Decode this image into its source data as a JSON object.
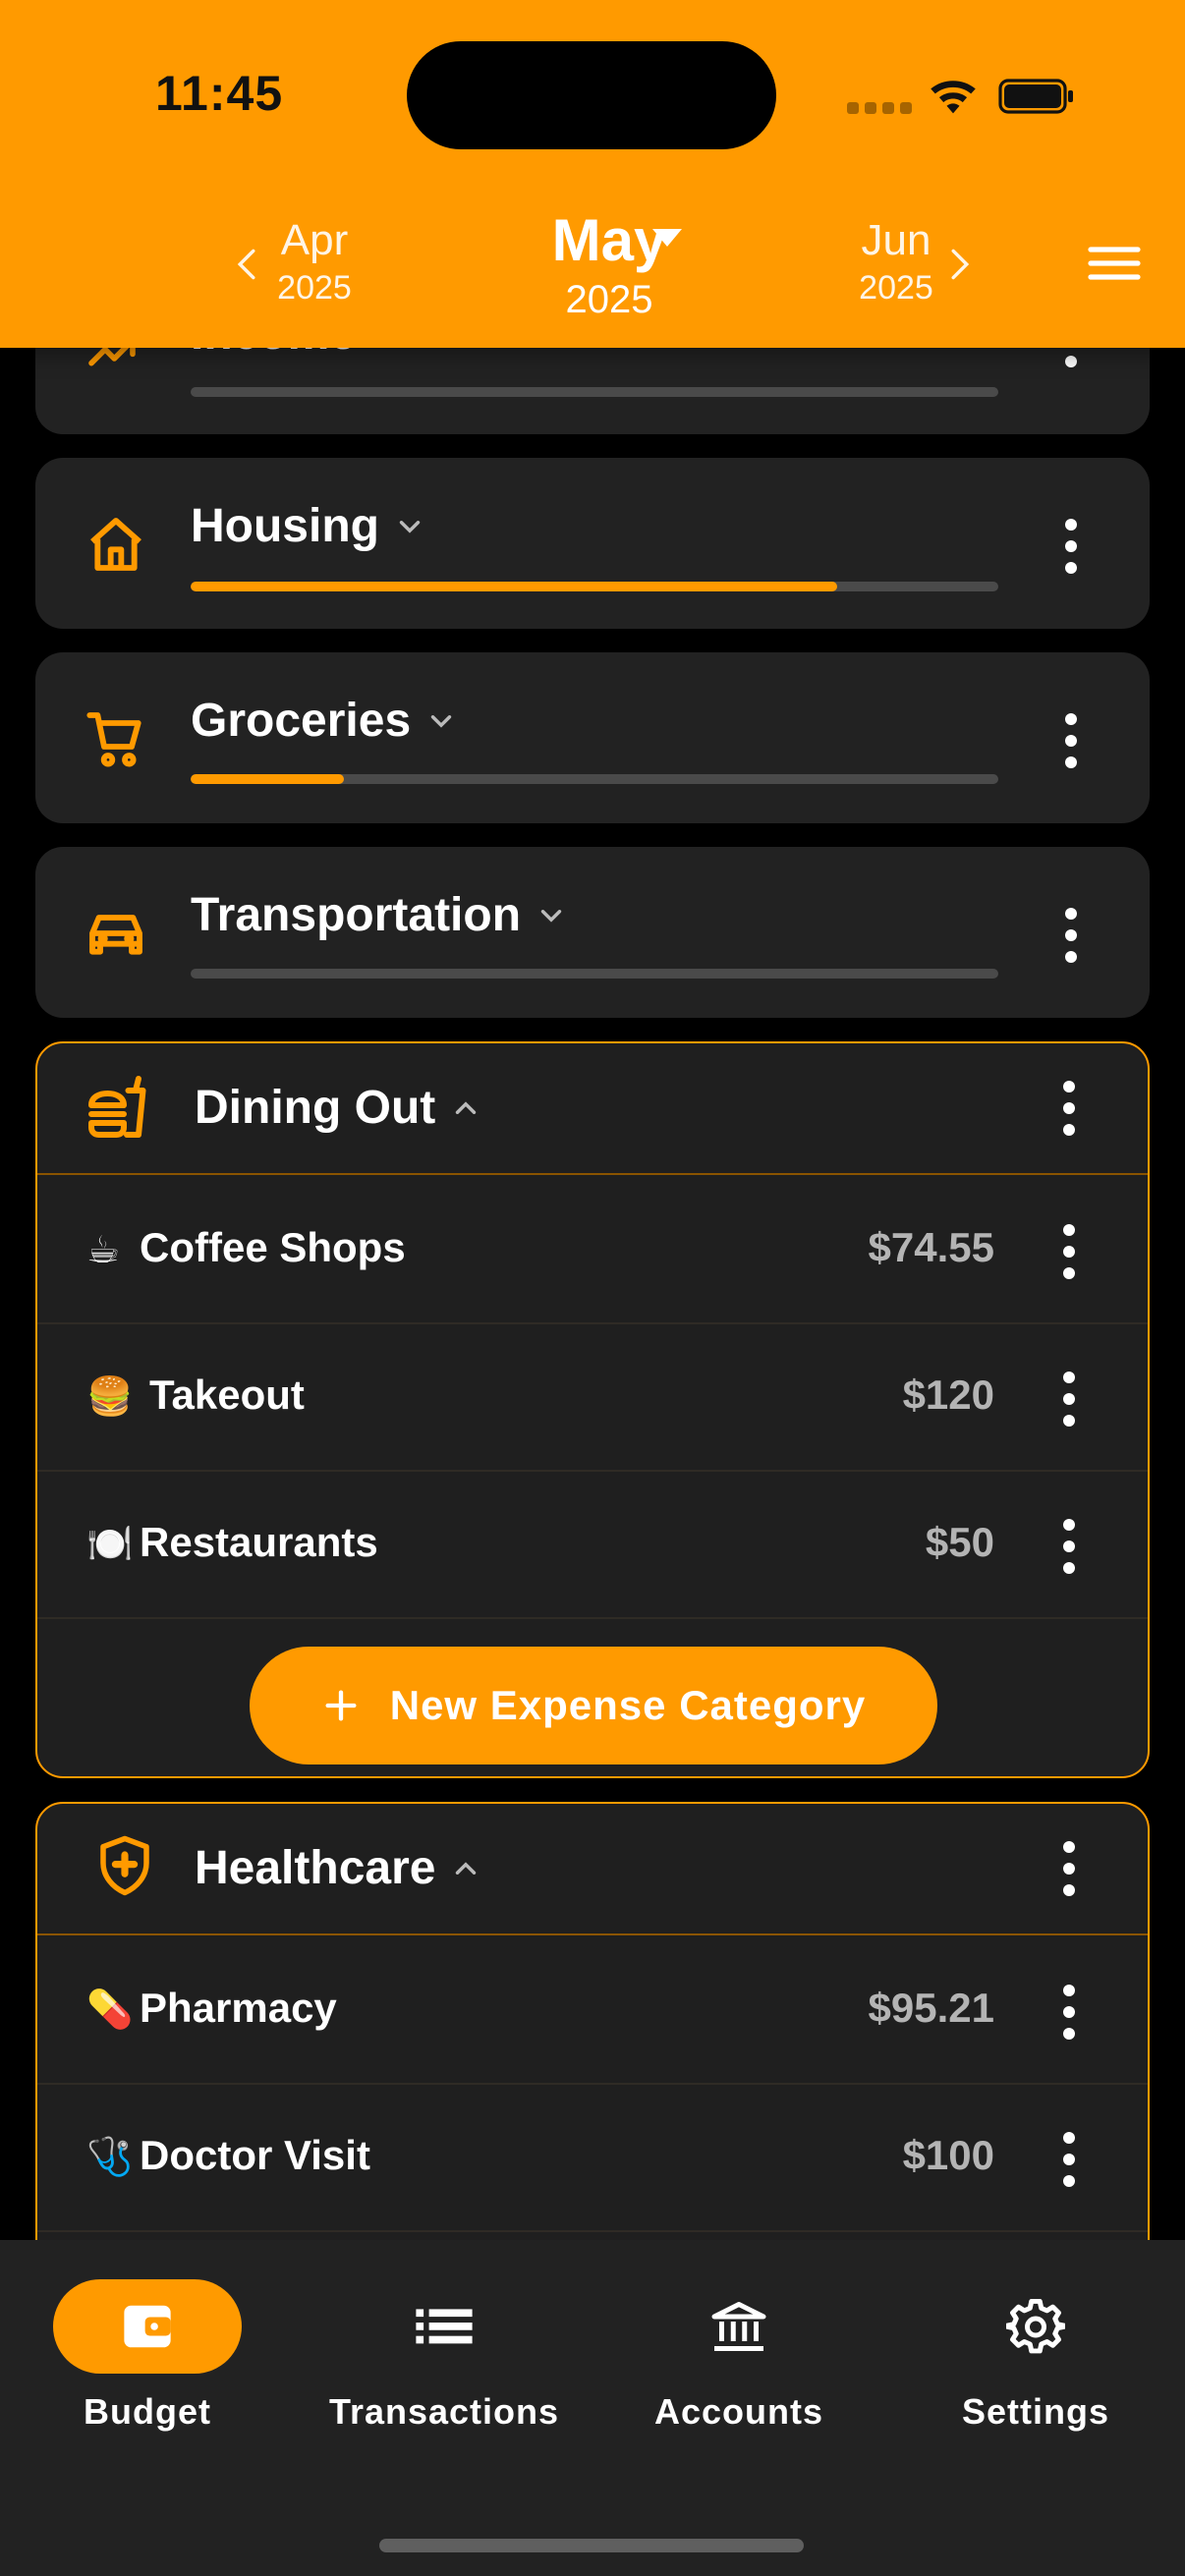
{
  "status_bar": {
    "time": "11:45"
  },
  "header": {
    "prev": {
      "month": "Apr",
      "year": "2025"
    },
    "current": {
      "month": "May",
      "year": "2025"
    },
    "next": {
      "month": "Jun",
      "year": "2025"
    }
  },
  "categories": [
    {
      "name": "Income",
      "icon": "trending-up-icon",
      "progress": 0.0
    },
    {
      "name": "Housing",
      "icon": "house-icon",
      "progress": 0.8
    },
    {
      "name": "Groceries",
      "icon": "cart-icon",
      "progress": 0.19
    },
    {
      "name": "Transportation",
      "icon": "car-icon",
      "progress": 0.0
    }
  ],
  "dining_out": {
    "name": "Dining Out",
    "icon": "fast-food-icon",
    "items": [
      {
        "emoji": "☕",
        "name": "Coffee Shops",
        "amount": "$74.55"
      },
      {
        "emoji": "🍔",
        "name": "Takeout",
        "amount": "$120"
      },
      {
        "emoji": "🍽️",
        "name": "Restaurants",
        "amount": "$50"
      }
    ],
    "new_button": "New Expense Category"
  },
  "healthcare": {
    "name": "Healthcare",
    "icon": "shield-plus-icon",
    "items": [
      {
        "emoji": "💊",
        "name": "Pharmacy",
        "amount": "$95.21"
      },
      {
        "emoji": "🩺",
        "name": "Doctor Visit",
        "amount": "$100"
      }
    ]
  },
  "nav": [
    {
      "label": "Budget",
      "icon": "wallet-icon",
      "active": true
    },
    {
      "label": "Transactions",
      "icon": "list-icon",
      "active": false
    },
    {
      "label": "Accounts",
      "icon": "bank-icon",
      "active": false
    },
    {
      "label": "Settings",
      "icon": "gear-icon",
      "active": false
    }
  ],
  "colors": {
    "accent": "#FF9A00",
    "card": "#222222",
    "background": "#000000"
  }
}
